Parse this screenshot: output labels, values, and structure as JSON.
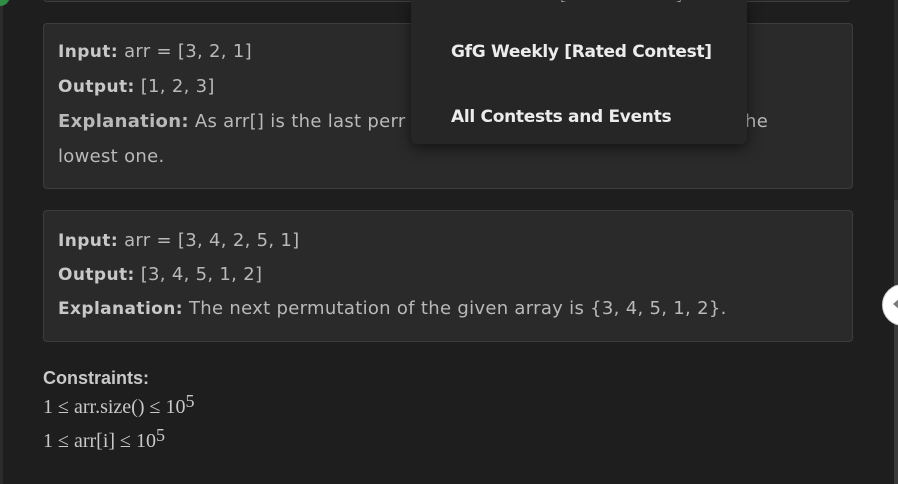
{
  "dropdown": {
    "items": [
      {
        "label": "GfG Weekly [Rated Contest]"
      },
      {
        "label": "All Contests and Events"
      }
    ]
  },
  "examples": [
    {
      "input_label": "Input:",
      "input_value": "arr = [3, 2, 1]",
      "output_label": "Output:",
      "output_value": "[1, 2, 3]",
      "explanation_label": "Explanation:",
      "explanation_visible_start": "As arr[] is the last perr",
      "explanation_visible_end": "he",
      "explanation_second_line": "lowest one."
    },
    {
      "input_label": "Input:",
      "input_value": "arr = [3, 4, 2, 5, 1]",
      "output_label": "Output:",
      "output_value": "[3, 4, 5, 1, 2]",
      "explanation_label": "Explanation:",
      "explanation_text": "The next permutation of the given array is {3, 4, 5, 1, 2}."
    }
  ],
  "constraints": {
    "title": "Constraints:",
    "items": [
      {
        "text": "1 ≤ arr.size() ≤ 10",
        "exponent": "5"
      },
      {
        "text": "1 ≤ arr[i] ≤ 10",
        "exponent": "5"
      }
    ]
  },
  "colors": {
    "background": "#1e1e1e",
    "box": "#2a2a2a",
    "accent_green": "#2f8d46"
  },
  "icons": {
    "collapse_handle": "chevron-left-icon"
  }
}
